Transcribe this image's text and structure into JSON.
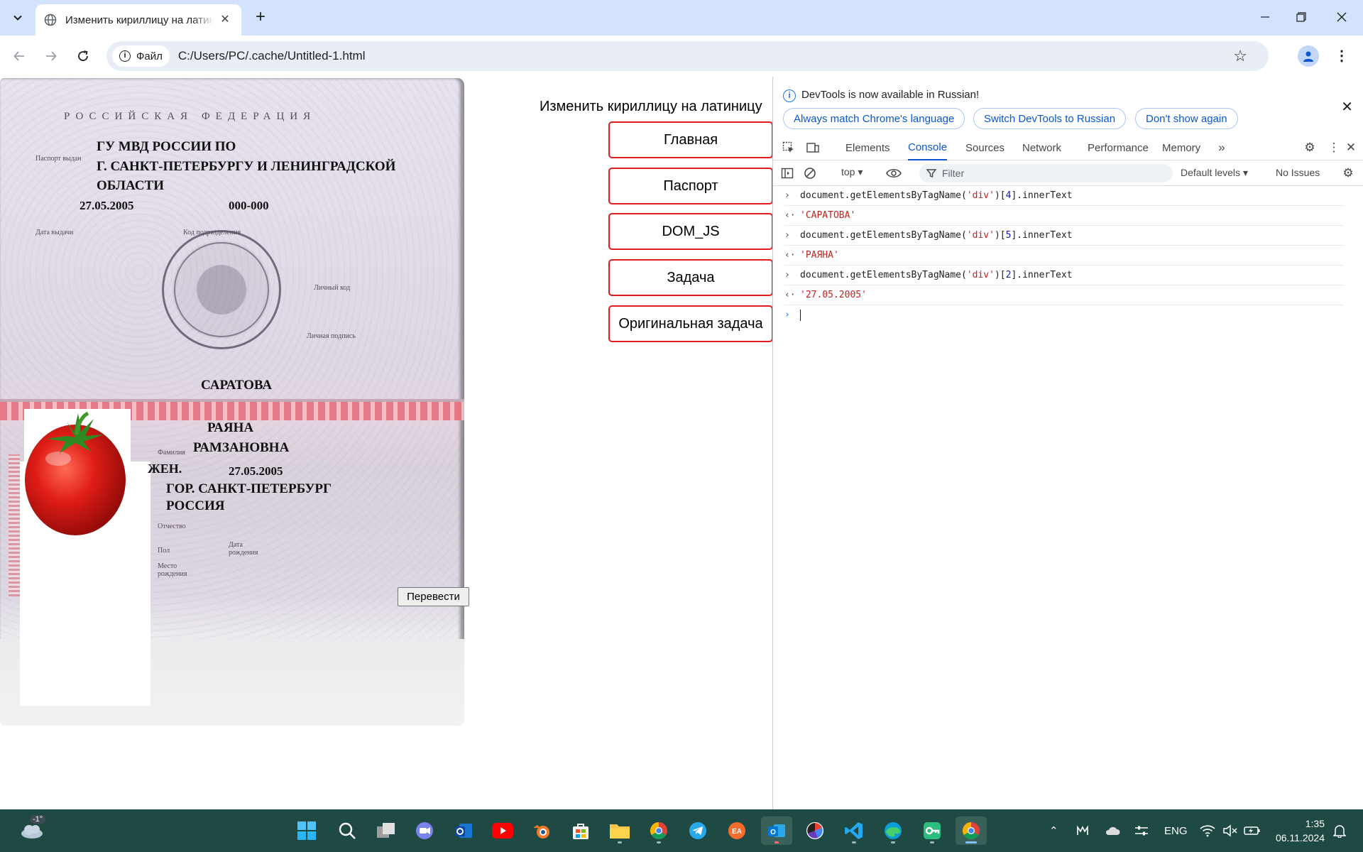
{
  "browser": {
    "tab_title": "Изменить кириллицу на латиницу",
    "new_tab_icon": "plus-icon",
    "address": {
      "protocol_chip": "Файл",
      "url": "C:/Users/PC/.cache/Untitled-1.html"
    }
  },
  "page": {
    "heading": "Изменить кириллицу на латиницу",
    "nav_buttons": [
      "Главная",
      "Паспорт",
      "DOM_JS",
      "Задача",
      "Оригинальная задача"
    ],
    "translate_button": "Перевести",
    "passport": {
      "country": "РОССИЙСКАЯ ФЕДЕРАЦИЯ",
      "issued_by_line1": "ГУ МВД РОССИИ ПО",
      "issued_by_line2": "Г. САНКТ-ПЕТЕРБУРГУ И ЛЕНИНГРАДСКОЙ",
      "issued_by_line3": "ОБЛАСТИ",
      "issue_date": "27.05.2005",
      "department_code": "000-000",
      "label_issued_by": "Паспорт выдан",
      "label_issue_date": "Дата выдачи",
      "label_department_code": "Код подразделения",
      "label_personal_code": "Личный код",
      "label_signature": "Личная подпись",
      "surname": "САРАТОВА",
      "given_name": "РАЯНА",
      "patronymic": "РАМЗАНОВНА",
      "sex": "ЖЕН.",
      "birth_date": "27.05.2005",
      "birth_place_line1": "ГОР. САНКТ-ПЕТЕРБУРГ",
      "birth_place_line2": "РОССИЯ",
      "label_surname": "Фамилия",
      "label_patronymic": "Отчество",
      "label_sex": "Пол",
      "label_birth_date": "Дата рождения",
      "label_birth_place_1": "Место",
      "label_birth_place_2": "рождения"
    }
  },
  "devtools": {
    "banner": {
      "text": "DevTools is now available in Russian!",
      "btn_match": "Always match Chrome's language",
      "btn_switch": "Switch DevTools to Russian",
      "btn_dismiss": "Don't show again"
    },
    "tabs": [
      "Elements",
      "Console",
      "Sources",
      "Network",
      "Performance",
      "Memory"
    ],
    "active_tab": "Console",
    "context": "top",
    "filter_placeholder": "Filter",
    "levels": "Default levels",
    "issues": "No Issues",
    "console": [
      {
        "input_prefix": "document.getElementsByTagName(",
        "arg": "'div'",
        "index_open": ")[",
        "index": "4",
        "index_close": "].innerText",
        "result": "'САРАТОВА'"
      },
      {
        "input_prefix": "document.getElementsByTagName(",
        "arg": "'div'",
        "index_open": ")[",
        "index": "5",
        "index_close": "].innerText",
        "result": "'РАЯНА'"
      },
      {
        "input_prefix": "document.getElementsByTagName(",
        "arg": "'div'",
        "index_open": ")[",
        "index": "2",
        "index_close": "].innerText",
        "result": "'27.05.2005'"
      }
    ]
  },
  "taskbar": {
    "weather": "-1°",
    "lang": "ENG",
    "time": "1:35",
    "date": "06.11.2024"
  },
  "colors": {
    "accent_nav_border": "#e21c1c",
    "devtools_active": "#0b57d0",
    "console_string": "#c5221f",
    "taskbar_bg": "#1e4a43",
    "tabstrip_bg": "#d3e3fd"
  }
}
